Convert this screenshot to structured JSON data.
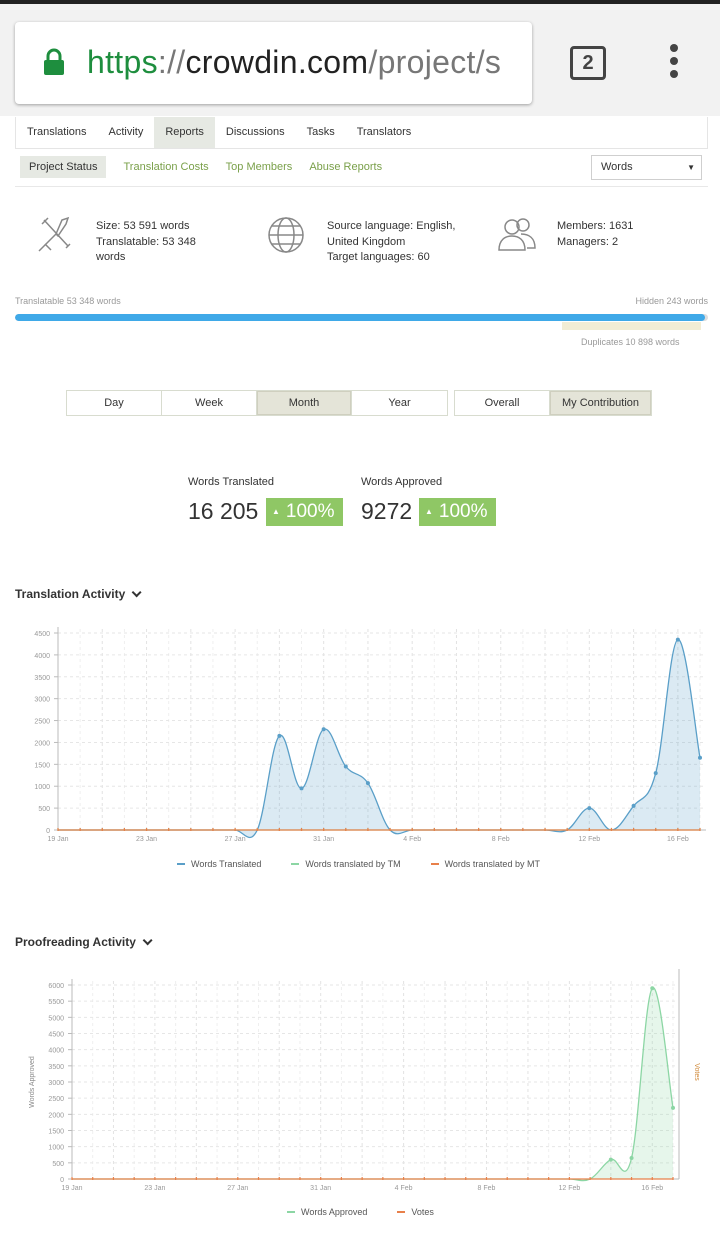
{
  "browser": {
    "url_scheme": "https",
    "url_sep": "://",
    "url_host": "crowdin.com",
    "url_path": "/project/s",
    "tab_count": "2",
    "lock_color": "#1e8e3e"
  },
  "nav": {
    "tabs": [
      "Translations",
      "Activity",
      "Reports",
      "Discussions",
      "Tasks",
      "Translators"
    ],
    "active": "Reports"
  },
  "subnav": {
    "tabs": [
      "Project Status",
      "Translation Costs",
      "Top Members",
      "Abuse Reports"
    ],
    "active": "Project Status",
    "unit_select": "Words"
  },
  "stats": {
    "size": "Size: 53 591 words",
    "translatable": "Translatable: 53 348 words",
    "source_language": "Source language: English, United Kingdom",
    "target_languages": "Target languages: 60",
    "members": "Members: 1631",
    "managers": "Managers: 2",
    "icons": [
      "tools-icon",
      "globe-icon",
      "members-icon"
    ]
  },
  "progress": {
    "translatable_label": "Translatable 53 348 words",
    "hidden_label": "Hidden 243 words",
    "duplicates_label": "Duplicates 10 898 words",
    "translatable_fraction": 0.9955,
    "duplicates_fraction": 0.2042,
    "color": "#3fa9e8"
  },
  "period": {
    "options": [
      "Day",
      "Week",
      "Month",
      "Year"
    ],
    "active": "Month"
  },
  "scope": {
    "options": [
      "Overall",
      "My Contribution"
    ],
    "active": "My Contribution"
  },
  "kpis": {
    "translated_label": "Words Translated",
    "translated_value": "16 205",
    "translated_change": "100%",
    "approved_label": "Words Approved",
    "approved_value": "9272",
    "approved_change": "100%",
    "badge_color": "#8fc765"
  },
  "translation_activity": {
    "title": "Translation Activity",
    "legend": [
      "Words Translated",
      "Words translated by TM",
      "Words translated by MT"
    ],
    "colors": [
      "#5a9fc8",
      "#8cd6a4",
      "#e8804a"
    ]
  },
  "proofreading_activity": {
    "title": "Proofreading Activity",
    "y_axis_label": "Words Approved",
    "y2_axis_label": "Votes",
    "legend": [
      "Words Approved",
      "Votes"
    ],
    "colors": [
      "#8cd6a4",
      "#e8804a"
    ]
  },
  "chart_data": [
    {
      "type": "area",
      "title": "Translation Activity",
      "x_tick_labels": [
        "19 Jan",
        "23 Jan",
        "27 Jan",
        "31 Jan",
        "4 Feb",
        "8 Feb",
        "12 Feb",
        "16 Feb"
      ],
      "x": [
        "19 Jan",
        "20 Jan",
        "21 Jan",
        "22 Jan",
        "23 Jan",
        "24 Jan",
        "25 Jan",
        "26 Jan",
        "27 Jan",
        "28 Jan",
        "29 Jan",
        "30 Jan",
        "31 Jan",
        "1 Feb",
        "2 Feb",
        "3 Feb",
        "4 Feb",
        "5 Feb",
        "6 Feb",
        "7 Feb",
        "8 Feb",
        "9 Feb",
        "10 Feb",
        "11 Feb",
        "12 Feb",
        "13 Feb",
        "14 Feb",
        "15 Feb",
        "16 Feb",
        "17 Feb"
      ],
      "ylim": [
        0,
        4500
      ],
      "y_ticks": [
        0,
        500,
        1000,
        1500,
        2000,
        2500,
        3000,
        3500,
        4000,
        4500
      ],
      "grid": true,
      "legend_position": "bottom",
      "series": [
        {
          "name": "Words Translated",
          "values": [
            0,
            0,
            0,
            0,
            0,
            0,
            0,
            0,
            0,
            0,
            2150,
            950,
            2300,
            1450,
            1070,
            0,
            0,
            0,
            0,
            0,
            0,
            0,
            0,
            0,
            500,
            0,
            550,
            1300,
            4350,
            1650
          ]
        },
        {
          "name": "Words translated by TM",
          "values": [
            0,
            0,
            0,
            0,
            0,
            0,
            0,
            0,
            0,
            0,
            0,
            0,
            0,
            0,
            0,
            0,
            0,
            0,
            0,
            0,
            0,
            0,
            0,
            0,
            0,
            0,
            0,
            0,
            0,
            0
          ]
        },
        {
          "name": "Words translated by MT",
          "values": [
            0,
            0,
            0,
            0,
            0,
            0,
            0,
            0,
            0,
            0,
            0,
            0,
            0,
            0,
            0,
            0,
            0,
            0,
            0,
            0,
            0,
            0,
            0,
            0,
            0,
            0,
            0,
            0,
            0,
            0
          ]
        }
      ]
    },
    {
      "type": "area",
      "title": "Proofreading Activity",
      "ylabel": "Words Approved",
      "y2label": "Votes",
      "x_tick_labels": [
        "19 Jan",
        "23 Jan",
        "27 Jan",
        "31 Jan",
        "4 Feb",
        "8 Feb",
        "12 Feb",
        "16 Feb"
      ],
      "x": [
        "19 Jan",
        "20 Jan",
        "21 Jan",
        "22 Jan",
        "23 Jan",
        "24 Jan",
        "25 Jan",
        "26 Jan",
        "27 Jan",
        "28 Jan",
        "29 Jan",
        "30 Jan",
        "31 Jan",
        "1 Feb",
        "2 Feb",
        "3 Feb",
        "4 Feb",
        "5 Feb",
        "6 Feb",
        "7 Feb",
        "8 Feb",
        "9 Feb",
        "10 Feb",
        "11 Feb",
        "12 Feb",
        "13 Feb",
        "14 Feb",
        "15 Feb",
        "16 Feb",
        "17 Feb"
      ],
      "ylim": [
        0,
        6000
      ],
      "y_ticks": [
        0,
        500,
        1000,
        1500,
        2000,
        2500,
        3000,
        3500,
        4000,
        4500,
        5000,
        5500,
        6000
      ],
      "grid": true,
      "legend_position": "bottom",
      "series": [
        {
          "name": "Words Approved",
          "values": [
            0,
            0,
            0,
            0,
            0,
            0,
            0,
            0,
            0,
            0,
            0,
            0,
            0,
            0,
            0,
            0,
            0,
            0,
            0,
            0,
            0,
            0,
            0,
            0,
            0,
            0,
            600,
            650,
            5900,
            2200
          ]
        },
        {
          "name": "Votes",
          "values": [
            0,
            0,
            0,
            0,
            0,
            0,
            0,
            0,
            0,
            0,
            0,
            0,
            0,
            0,
            0,
            0,
            0,
            0,
            0,
            0,
            0,
            0,
            0,
            0,
            0,
            0,
            0,
            0,
            0,
            0
          ]
        }
      ]
    }
  ]
}
